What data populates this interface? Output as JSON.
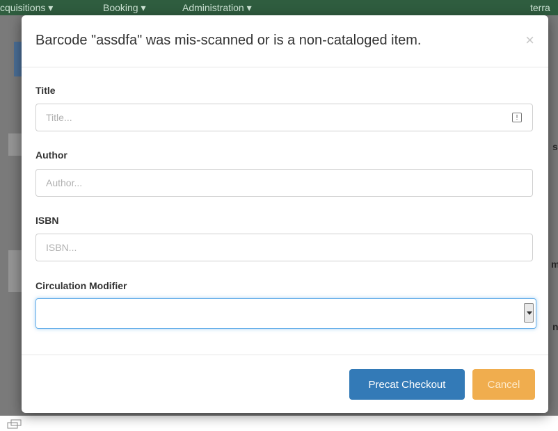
{
  "navbar": {
    "items": [
      "cquisitions ▾",
      "Booking ▾",
      "Administration ▾"
    ],
    "user": "terra"
  },
  "background": {
    "right_chars": [
      "s",
      "m",
      "n"
    ]
  },
  "modal": {
    "title": "Barcode \"assdfa\" was mis-scanned or is a non-cataloged item.",
    "close_symbol": "×",
    "fields": {
      "title": {
        "label": "Title",
        "placeholder": "Title...",
        "value": "",
        "icon": "!"
      },
      "author": {
        "label": "Author",
        "placeholder": "Author...",
        "value": ""
      },
      "isbn": {
        "label": "ISBN",
        "placeholder": "ISBN...",
        "value": ""
      },
      "circ_modifier": {
        "label": "Circulation Modifier",
        "selected": ""
      }
    },
    "buttons": {
      "precat": "Precat Checkout",
      "cancel": "Cancel"
    }
  },
  "colors": {
    "primary": "#337ab7",
    "warning": "#f0ad4e",
    "navbar": "#2f5d3f",
    "focus": "#66afe9"
  }
}
